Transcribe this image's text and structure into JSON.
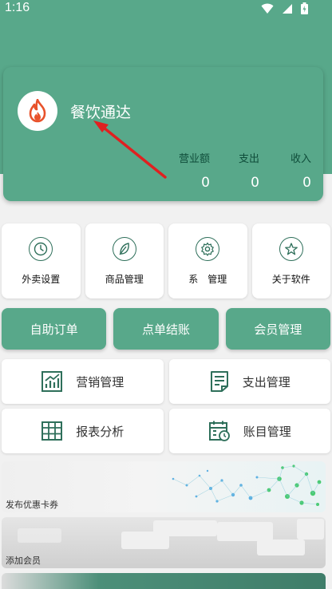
{
  "status": {
    "time": "1:16"
  },
  "app": {
    "title": "餐饮通达"
  },
  "stats": [
    {
      "label": "营业额",
      "value": "0"
    },
    {
      "label": "支出",
      "value": "0"
    },
    {
      "label": "收入",
      "value": "0"
    }
  ],
  "grid": [
    {
      "label": "外卖设置",
      "icon": "clock-icon"
    },
    {
      "label": "商品管理",
      "icon": "feather-icon"
    },
    {
      "label": "系　管理",
      "icon": "gear-icon"
    },
    {
      "label": "关于软件",
      "icon": "star-icon"
    }
  ],
  "actions": [
    {
      "label": "自助订单"
    },
    {
      "label": "点单结账"
    },
    {
      "label": "会员管理"
    }
  ],
  "modules": [
    {
      "label": "营销管理",
      "icon": "chart-icon"
    },
    {
      "label": "支出管理",
      "icon": "document-icon"
    },
    {
      "label": "报表分析",
      "icon": "table-icon"
    },
    {
      "label": "账目管理",
      "icon": "calendar-icon"
    }
  ],
  "banners": [
    {
      "label": "发布优惠卡券"
    },
    {
      "label": "添加会员"
    }
  ],
  "colors": {
    "primary": "#58a88a",
    "accent_dark": "#2e6f5a",
    "fire": "#e8522b",
    "arrow": "#e02020"
  }
}
